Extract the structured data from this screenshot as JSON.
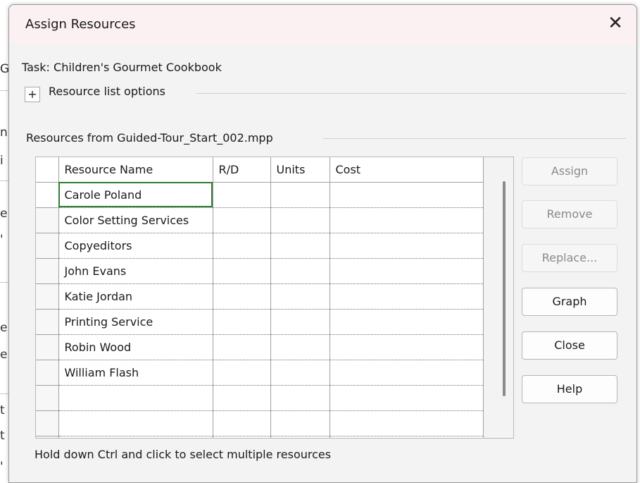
{
  "background": {
    "edge_glyphs": [
      "G",
      "n",
      "i",
      "e",
      "'",
      "e",
      "e",
      "t",
      "t",
      "'"
    ]
  },
  "dialog": {
    "title": "Assign Resources",
    "close_glyph": "✕",
    "task_label": "Task:",
    "task_name": "Children's Gourmet Cookbook",
    "expander_glyph": "+",
    "resource_list_options": "Resource list options",
    "resources_group_label": "Resources from Guided-Tour_Start_002.mpp",
    "grid": {
      "columns": [
        "Resource Name",
        "R/D",
        "Units",
        "Cost"
      ],
      "rows": [
        {
          "name": "Carole Poland",
          "rd": "",
          "units": "",
          "cost": ""
        },
        {
          "name": "Color Setting Services",
          "rd": "",
          "units": "",
          "cost": ""
        },
        {
          "name": "Copyeditors",
          "rd": "",
          "units": "",
          "cost": ""
        },
        {
          "name": "John Evans",
          "rd": "",
          "units": "",
          "cost": ""
        },
        {
          "name": "Katie Jordan",
          "rd": "",
          "units": "",
          "cost": ""
        },
        {
          "name": "Printing Service",
          "rd": "",
          "units": "",
          "cost": ""
        },
        {
          "name": "Robin Wood",
          "rd": "",
          "units": "",
          "cost": ""
        },
        {
          "name": "William Flash",
          "rd": "",
          "units": "",
          "cost": ""
        },
        {
          "name": "",
          "rd": "",
          "units": "",
          "cost": ""
        },
        {
          "name": "",
          "rd": "",
          "units": "",
          "cost": ""
        },
        {
          "name": "",
          "rd": "",
          "units": "",
          "cost": ""
        }
      ]
    },
    "buttons": {
      "assign": "Assign",
      "remove": "Remove",
      "replace": "Replace...",
      "graph": "Graph",
      "close": "Close",
      "help": "Help"
    },
    "hint": "Hold down Ctrl and click to select multiple resources"
  },
  "colors": {
    "titlebar": "#fbf0f2",
    "dialog_bg": "#f3f3f3",
    "selection_outline": "#2e7d32",
    "disabled_text": "#8a8a8a"
  }
}
